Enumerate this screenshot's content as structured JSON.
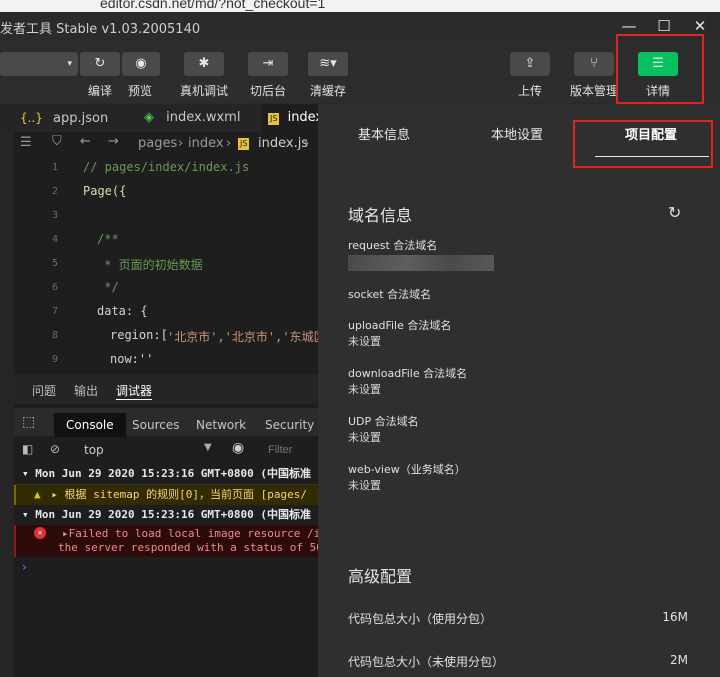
{
  "browser": {
    "url": "editor.csdn.net/md/?not_checkout=1"
  },
  "window": {
    "title": "发者工具 Stable v1.03.2005140",
    "min": "—",
    "max": "☐",
    "close": "✕"
  },
  "toolbar": {
    "compile": "编译",
    "preview": "预览",
    "realdebug": "真机调试",
    "background": "切后台",
    "clearcache": "清缓存",
    "upload": "上传",
    "version": "版本管理",
    "details": "详情"
  },
  "colors": {
    "accent": "#07c160",
    "highlight": "#e02424"
  },
  "tabs": [
    {
      "label": "app.json"
    },
    {
      "label": "index.wxml"
    },
    {
      "label": "index"
    }
  ],
  "breadcrumb": {
    "p1": "pages",
    "p2": "index",
    "file": "index.js"
  },
  "code": {
    "lines": [
      "1",
      "2",
      "3",
      "4",
      "5",
      "6",
      "7",
      "8",
      "9"
    ],
    "c1": "// pages/index/index.js",
    "c2": "Page({",
    "c4": "/**",
    "c5": " * 页面的初始数据",
    "c6": " */",
    "c7": "data: {",
    "c8_key": "region:[",
    "c8_val": "'北京市','北京市','东城区",
    "c9": "now:''"
  },
  "debug": {
    "tabs": {
      "problems": "问题",
      "output": "输出",
      "debugger": "调试器"
    },
    "console_tabs": {
      "console": "Console",
      "sources": "Sources",
      "network": "Network",
      "security": "Security"
    },
    "context": "top",
    "filter_placeholder": "Filter",
    "log1": "▾ Mon Jun 29 2020 15:23:16 GMT+0800 (中国标准",
    "warn": "▸ 根据 sitemap 的规则[0]，当前页面 [pages/",
    "log2": "▾ Mon Jun 29 2020 15:23:16 GMT+0800 (中国标准",
    "err1": "▸Failed to load local image resource /im",
    "err2": "the server responded with a status of 50"
  },
  "right": {
    "tabs": {
      "basic": "基本信息",
      "local": "本地设置",
      "project": "项目配置"
    },
    "domain_title": "域名信息",
    "request": "request 合法域名",
    "socket": "socket 合法域名",
    "upload": "uploadFile 合法域名",
    "upload_val": "未设置",
    "download": "downloadFile 合法域名",
    "download_val": "未设置",
    "udp": "UDP 合法域名",
    "udp_val": "未设置",
    "webview": "web-view（业务域名）",
    "webview_val": "未设置",
    "advanced_title": "高级配置",
    "size_sub": "代码包总大小（使用分包）",
    "size_sub_val": "16M",
    "size_nosub": "代码包总大小（未使用分包）",
    "size_nosub_val": "2M"
  }
}
